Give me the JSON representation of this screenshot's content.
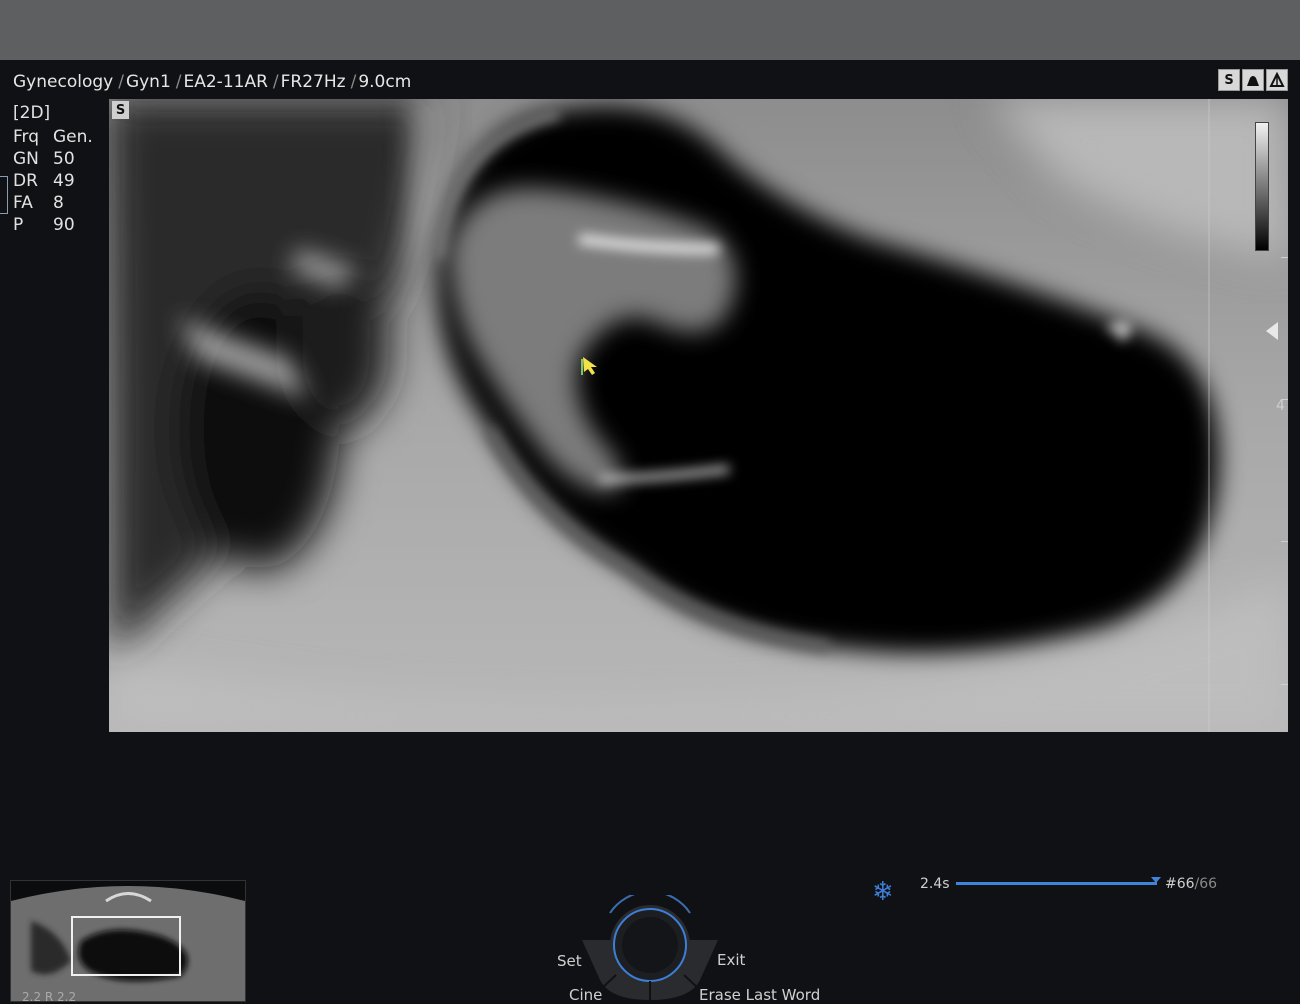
{
  "header": {
    "segments": [
      "Gynecology",
      "Gyn1",
      "EA2-11AR",
      "FR27Hz",
      "9.0cm"
    ],
    "separator": "/"
  },
  "header_icons": [
    {
      "name": "s-har-icon",
      "label": "S"
    },
    {
      "name": "probe-icon",
      "label": ""
    },
    {
      "name": "biopsy-icon",
      "label": ""
    }
  ],
  "params": {
    "mode": "[2D]",
    "rows": [
      {
        "key": "Frq",
        "value": "Gen."
      },
      {
        "key": "GN",
        "value": "50"
      },
      {
        "key": "DR",
        "value": "49"
      },
      {
        "key": "FA",
        "value": "8"
      },
      {
        "key": "P",
        "value": "90"
      }
    ]
  },
  "image": {
    "badge": "S",
    "depth_marker": "4"
  },
  "cine": {
    "time": "2.4s",
    "frame": "#66",
    "total": "66",
    "progress": 1.0,
    "accent_color": "#3e84dc"
  },
  "trackball": {
    "set": "Set",
    "exit": "Exit",
    "cine": "Cine",
    "erase": "Erase Last Word"
  },
  "thumbnail": {
    "caption": "2.2 R 2.2"
  }
}
